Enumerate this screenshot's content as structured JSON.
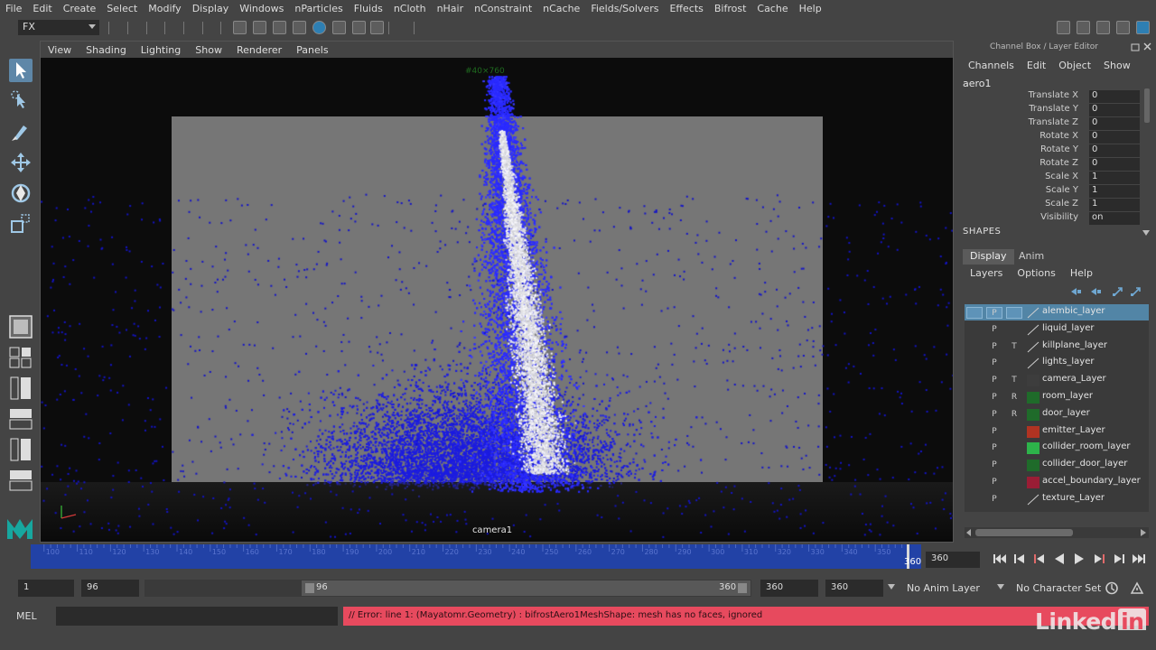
{
  "menu": [
    "File",
    "Edit",
    "Create",
    "Select",
    "Modify",
    "Display",
    "Windows",
    "nParticles",
    "Fluids",
    "nCloth",
    "nHair",
    "nConstraint",
    "nCache",
    "Fields/Solvers",
    "Effects",
    "Bifrost",
    "Cache",
    "Help"
  ],
  "status": {
    "mode": "FX"
  },
  "viewport": {
    "menu": [
      "View",
      "Shading",
      "Lighting",
      "Show",
      "Renderer",
      "Panels"
    ],
    "camera_label": "camera1",
    "hud_top": "#40×760"
  },
  "channel_box": {
    "title": "Channel Box / Layer Editor",
    "menu": [
      "Channels",
      "Edit",
      "Object",
      "Show"
    ],
    "object": "aero1",
    "channels": [
      {
        "label": "Translate X",
        "value": "0"
      },
      {
        "label": "Translate Y",
        "value": "0"
      },
      {
        "label": "Translate Z",
        "value": "0"
      },
      {
        "label": "Rotate X",
        "value": "0"
      },
      {
        "label": "Rotate Y",
        "value": "0"
      },
      {
        "label": "Rotate Z",
        "value": "0"
      },
      {
        "label": "Scale X",
        "value": "1"
      },
      {
        "label": "Scale Y",
        "value": "1"
      },
      {
        "label": "Scale Z",
        "value": "1"
      },
      {
        "label": "Visibility",
        "value": "on"
      }
    ],
    "shapes_label": "SHAPES"
  },
  "layer_editor": {
    "tabs": [
      "Display",
      "Anim"
    ],
    "menu": [
      "Layers",
      "Options",
      "Help"
    ],
    "layers": [
      {
        "name": "alembic_layer",
        "vis": "",
        "play": "P",
        "ref": "",
        "swatch": "none",
        "selected": true
      },
      {
        "name": "liquid_layer",
        "vis": "",
        "play": "P",
        "ref": "",
        "swatch": "none",
        "selected": false
      },
      {
        "name": "killplane_layer",
        "vis": "",
        "play": "P",
        "ref": "T",
        "swatch": "none",
        "selected": false
      },
      {
        "name": "lights_layer",
        "vis": "",
        "play": "P",
        "ref": "",
        "swatch": "none",
        "selected": false
      },
      {
        "name": "camera_Layer",
        "vis": "",
        "play": "P",
        "ref": "T",
        "swatch": "#3d3d3d",
        "selected": false
      },
      {
        "name": "room_layer",
        "vis": "",
        "play": "P",
        "ref": "R",
        "swatch": "#1f6b2a",
        "selected": false
      },
      {
        "name": "door_layer",
        "vis": "",
        "play": "P",
        "ref": "R",
        "swatch": "#1f6b2a",
        "selected": false
      },
      {
        "name": "emitter_Layer",
        "vis": "",
        "play": "P",
        "ref": "",
        "swatch": "#b03322",
        "selected": false
      },
      {
        "name": "collider_room_layer",
        "vis": "",
        "play": "P",
        "ref": "",
        "swatch": "#2db34a",
        "selected": false
      },
      {
        "name": "collider_door_layer",
        "vis": "",
        "play": "P",
        "ref": "",
        "swatch": "#1f6b2a",
        "selected": false
      },
      {
        "name": "accel_boundary_layer",
        "vis": "",
        "play": "P",
        "ref": "",
        "swatch": "#9a1d35",
        "selected": false
      },
      {
        "name": "texture_Layer",
        "vis": "",
        "play": "P",
        "ref": "",
        "swatch": "none",
        "selected": false
      }
    ]
  },
  "timeline": {
    "current_frame": "360",
    "end_frame_field": "360",
    "ticks": [
      "100",
      "110",
      "120",
      "130",
      "140",
      "150",
      "160",
      "170",
      "180",
      "190",
      "200",
      "210",
      "220",
      "230",
      "240",
      "250",
      "260",
      "270",
      "280",
      "290",
      "300",
      "310",
      "320",
      "330",
      "340",
      "350"
    ],
    "slider_color": "#2242a6"
  },
  "range": {
    "start": "1",
    "playback_start": "96",
    "thumb_left": "96",
    "thumb_right": "360",
    "playback_end": "360",
    "end": "360",
    "anim_layer": "No Anim Layer",
    "character_set": "No Character Set"
  },
  "command": {
    "language": "MEL",
    "error": "// Error: line 1: (Mayatomr.Geometry) : bifrostAero1MeshShape: mesh has no faces, ignored",
    "error_color": "#e74a5e"
  },
  "watermark": {
    "text": "Linked",
    "suffix": "in"
  }
}
